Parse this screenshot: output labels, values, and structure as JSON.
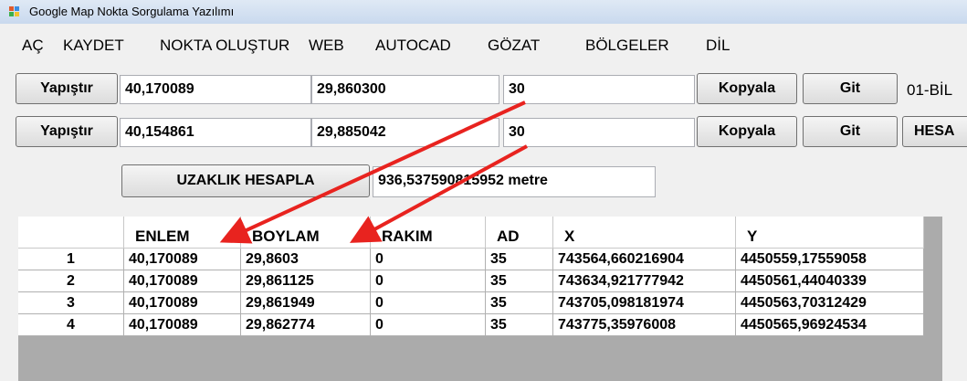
{
  "window": {
    "title": "Google Map Nokta Sorgulama Yazılımı"
  },
  "menu": [
    "AÇ",
    "KAYDET",
    "NOKTA OLUŞTUR",
    "WEB",
    "AUTOCAD",
    "GÖZAT",
    "BÖLGELER",
    "DİL"
  ],
  "point1": {
    "paste_label": "Yapıştır",
    "lat": "40,170089",
    "lon": "29,860300",
    "alt": "30",
    "copy_label": "Kopyala",
    "go_label": "Git",
    "combo_value": "01-BİL"
  },
  "point2": {
    "paste_label": "Yapıştır",
    "lat": "40,154861",
    "lon": "29,885042",
    "alt": "30",
    "copy_label": "Kopyala",
    "go_label": "Git",
    "calc_label": "HESA"
  },
  "distance": {
    "button_label": "UZAKLIK HESAPLA",
    "result": "936,537590815952 metre"
  },
  "table": {
    "columns": [
      "ENLEM",
      "BOYLAM",
      "RAKIM",
      "AD",
      "X",
      "Y"
    ],
    "rows": [
      {
        "num": "1",
        "cells": [
          "40,170089",
          "29,8603",
          "0",
          "35",
          "743564,660216904",
          "4450559,17559058"
        ]
      },
      {
        "num": "2",
        "cells": [
          "40,170089",
          "29,861125",
          "0",
          "35",
          "743634,921777942",
          "4450561,44040339"
        ]
      },
      {
        "num": "3",
        "cells": [
          "40,170089",
          "29,861949",
          "0",
          "35",
          "743705,098181974",
          "4450563,70312429"
        ]
      },
      {
        "num": "4",
        "cells": [
          "40,170089",
          "29,862774",
          "0",
          "35",
          "743775,35976008",
          "4450565,96924534"
        ]
      }
    ]
  },
  "colors": {
    "annotation_arrow": "#e8231f",
    "titlebar": "#c9d9ee",
    "grid_background": "#ababab"
  },
  "icons": {
    "app": "app-logo-icon"
  }
}
